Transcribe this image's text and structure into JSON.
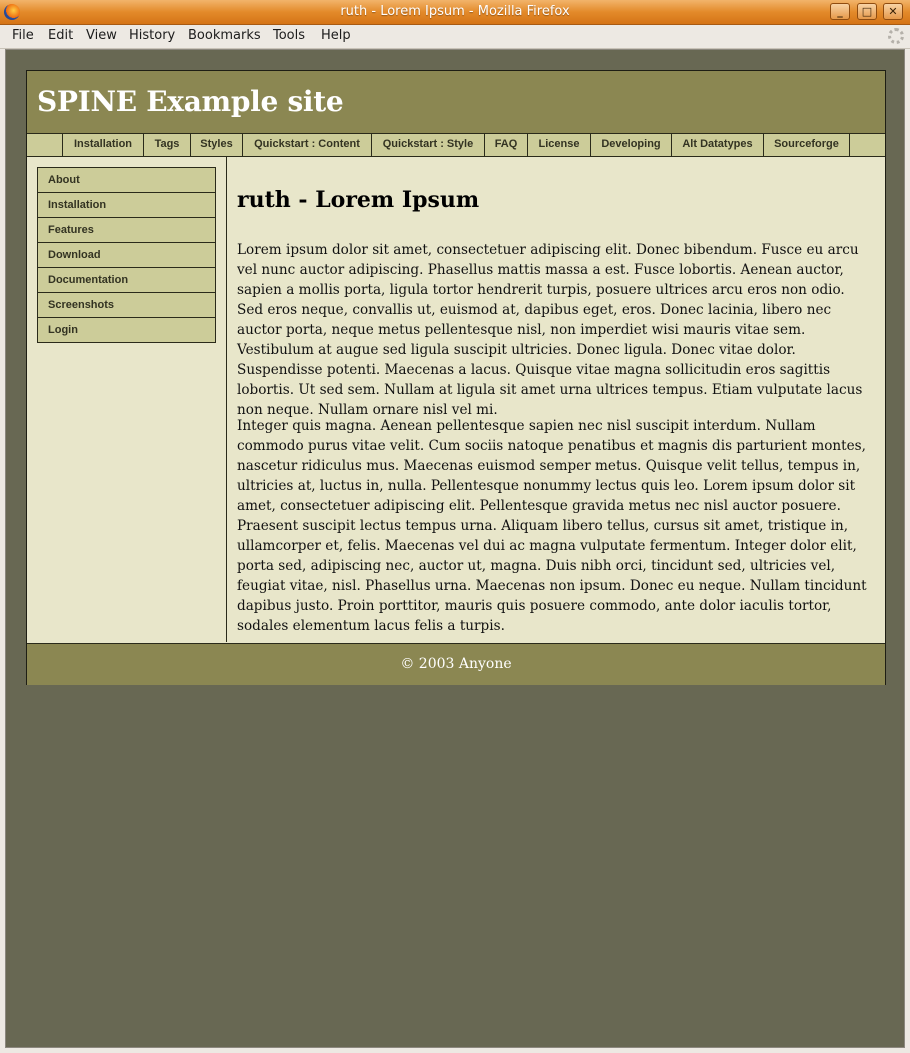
{
  "window": {
    "title": "ruth - Lorem Ipsum - Mozilla Firefox",
    "minimize_glyph": "_",
    "maximize_glyph": "□",
    "close_glyph": "✕"
  },
  "menubar": {
    "items": [
      "File",
      "Edit",
      "View",
      "History",
      "Bookmarks",
      "Tools",
      "Help"
    ]
  },
  "site": {
    "title": "SPINE Example site",
    "topnav": [
      "Installation",
      "Tags",
      "Styles",
      "Quickstart : Content",
      "Quickstart : Style",
      "FAQ",
      "License",
      "Developing",
      "Alt Datatypes",
      "Sourceforge"
    ],
    "sidebar": [
      "About",
      "Installation",
      "Features",
      "Download",
      "Documentation",
      "Screenshots",
      "Login"
    ],
    "page_title": "ruth - Lorem Ipsum",
    "paragraphs": [
      "Lorem ipsum dolor sit amet, consectetuer adipiscing elit. Donec bibendum. Fusce eu arcu vel nunc auctor adipiscing. Phasellus mattis massa a est. Fusce lobortis. Aenean auctor, sapien a mollis porta, ligula tortor hendrerit turpis, posuere ultrices arcu eros non odio. Sed eros neque, convallis ut, euismod at, dapibus eget, eros. Donec lacinia, libero nec auctor porta, neque metus pellentesque nisl, non imperdiet wisi mauris vitae sem. Vestibulum at augue sed ligula suscipit ultricies. Donec ligula. Donec vitae dolor. Suspendisse potenti. Maecenas a lacus. Quisque vitae magna sollicitudin eros sagittis lobortis. Ut sed sem. Nullam at ligula sit amet urna ultrices tempus. Etiam vulputate lacus non neque. Nullam ornare nisl vel mi.",
      "Integer quis magna. Aenean pellentesque sapien nec nisl suscipit interdum. Nullam commodo purus vitae velit. Cum sociis natoque penatibus et magnis dis parturient montes, nascetur ridiculus mus. Maecenas euismod semper metus. Quisque velit tellus, tempus in, ultricies at, luctus in, nulla. Pellentesque nonummy lectus quis leo. Lorem ipsum dolor sit amet, consectetuer adipiscing elit. Pellentesque gravida metus nec nisl auctor posuere. Praesent suscipit lectus tempus urna. Aliquam libero tellus, cursus sit amet, tristique in, ullamcorper et, felis. Maecenas vel dui ac magna vulputate fermentum. Integer dolor elit, porta sed, adipiscing nec, auctor ut, magna. Duis nibh orci, tincidunt sed, ultricies vel, feugiat vitae, nisl. Phasellus urna. Maecenas non ipsum. Donec eu neque. Nullam tincidunt dapibus justo. Proin porttitor, mauris quis posuere commodo, ante dolor iaculis tortor, sodales elementum lacus felis a turpis."
    ],
    "footer": "© 2003 Anyone"
  },
  "colors": {
    "header": "#8b8752",
    "nav": "#cccc99",
    "content_bg": "#e8e6ca",
    "page_bg": "#686853",
    "titlebar": "#e38a2a"
  },
  "icons": {
    "app": "firefox-icon",
    "throbber": "throbber-icon"
  }
}
